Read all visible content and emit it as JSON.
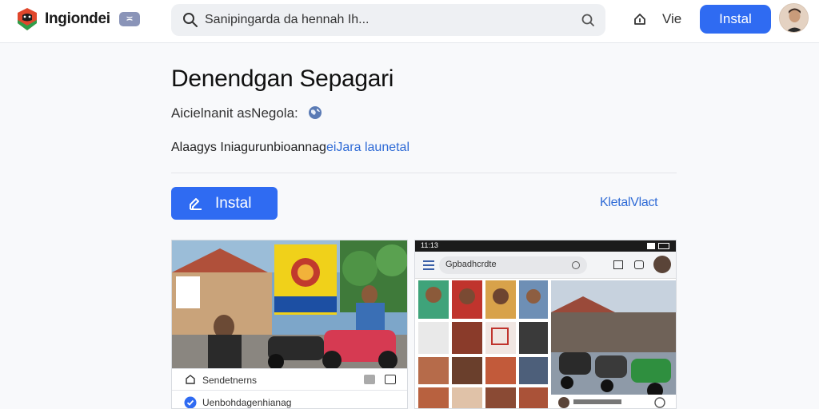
{
  "header": {
    "brand": "Ingiondei",
    "brand_badge": "≍",
    "search_placeholder": "Sanipingarda da hennah Ih...",
    "nav_label": "Vie",
    "install_label": "Instal"
  },
  "app": {
    "title": "Denendgan Sepagari",
    "subtitle": "Aicielnanit asNegola:",
    "description_prefix": "Alaagys Iniagurunbioannag",
    "description_link": "eiJara launetal",
    "install_label": "Instal",
    "side_link": "KletalVlact"
  },
  "screenshots": [
    {
      "footer_row1": "Sendetnerns",
      "footer_row2": "Uenbohdagenhianag"
    },
    {
      "status_time": "11:13",
      "search_text": "Gpbadhcrdte"
    }
  ],
  "colors": {
    "accent": "#2f6bf2",
    "link": "#2f6bd6",
    "logo_red": "#e0472c",
    "logo_green": "#2e9e4a"
  }
}
